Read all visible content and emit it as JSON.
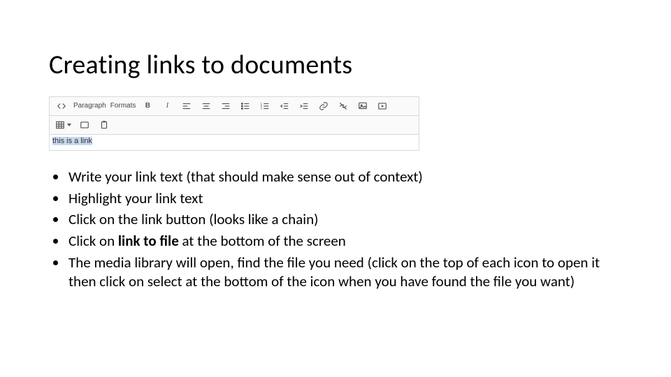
{
  "title": "Creating links to documents",
  "toolbar": {
    "paragraph_label": "Paragraph",
    "formats_label": "Formats"
  },
  "editor_text": "this is a link",
  "items": [
    "Write your link text (that should make sense out of context)",
    "Highlight your link text",
    "Click on the link button (looks like a chain)",
    "Click on <b>link to file</b> at the bottom of the screen",
    "The media library will open, find the file you need (click on the top of each icon to open it then click on select at the bottom of the icon when you have found the file you want)"
  ]
}
